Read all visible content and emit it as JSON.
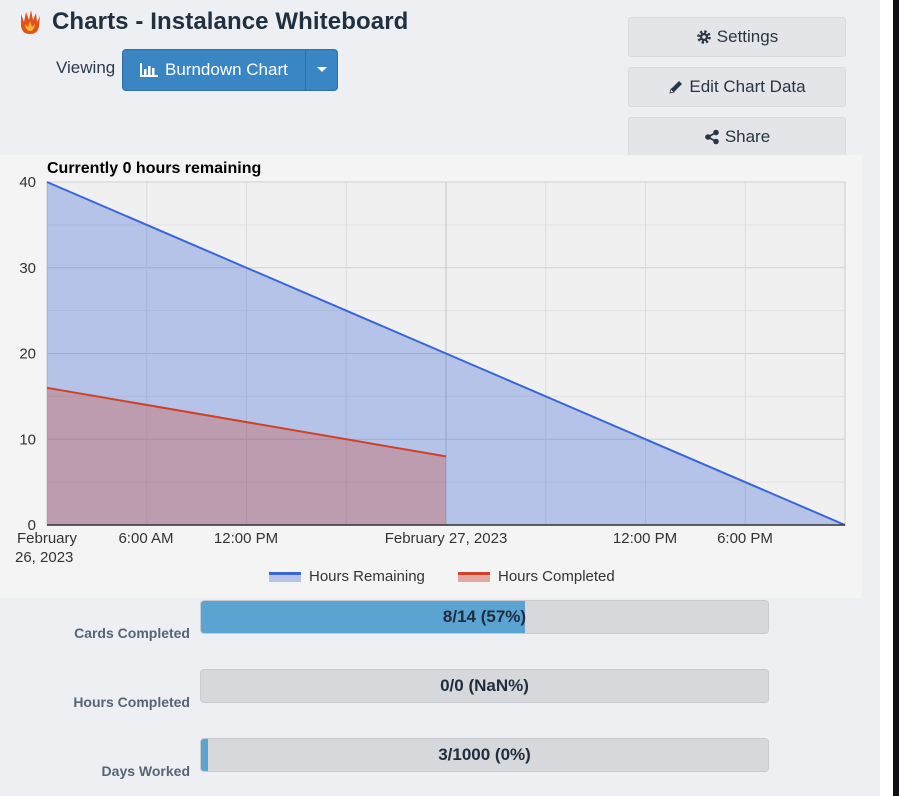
{
  "app": {
    "title": "Charts - Instalance Whiteboard",
    "icon": "flame-icon"
  },
  "viewing": {
    "label": "Viewing",
    "selected": "Burndown Chart",
    "icon": "bar-chart-icon"
  },
  "actions": {
    "settings": "Settings",
    "edit": "Edit Chart Data",
    "share": "Share"
  },
  "colors": {
    "accent": "#3a86c4",
    "remaining": "#3a67d6",
    "completed": "#d0412a",
    "progress": "#5ba4d2"
  },
  "chart_data": {
    "type": "area",
    "title": "Currently 0 hours remaining",
    "xlabel": "",
    "ylabel": "",
    "ylim": [
      0,
      40
    ],
    "y_ticks": [
      "0",
      "10",
      "20",
      "30",
      "40"
    ],
    "x_ticks": [
      "February 26, 2023",
      "6:00 AM",
      "12:00 PM",
      "February 27, 2023",
      "12:00 PM",
      "6:00 PM"
    ],
    "xlim": [
      "2023-02-26 00:00",
      "2023-02-28 00:00"
    ],
    "grid": true,
    "legend_position": "bottom",
    "series": [
      {
        "name": "Hours Remaining",
        "x": [
          "2023-02-26 00:00",
          "2023-02-28 00:00"
        ],
        "values": [
          40,
          0
        ]
      },
      {
        "name": "Hours Completed",
        "x": [
          "2023-02-26 00:00",
          "2023-02-27 00:00"
        ],
        "values": [
          16,
          8
        ]
      }
    ]
  },
  "stats": [
    {
      "label": "Cards Completed",
      "text": "8/14 (57%)",
      "fraction": 0.5714
    },
    {
      "label": "Hours Completed",
      "text": "0/0 (NaN%)",
      "fraction": 0
    },
    {
      "label": "Days Worked",
      "text": "3/1000 (0%)",
      "fraction": 0.003
    }
  ]
}
